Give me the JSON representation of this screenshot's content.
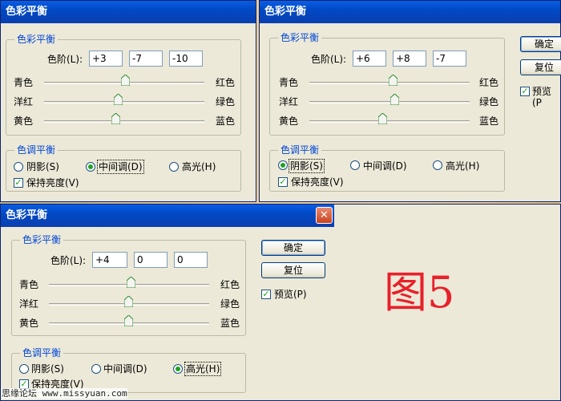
{
  "dialogs": [
    {
      "title": "色彩平衡",
      "color_balance": {
        "group_title": "色彩平衡",
        "levels_label": "色阶(L):",
        "levels": [
          "+3",
          "-7",
          "-10"
        ],
        "sliders": [
          {
            "left": "青色",
            "right": "红色"
          },
          {
            "left": "洋红",
            "right": "绿色"
          },
          {
            "left": "黄色",
            "right": "蓝色"
          }
        ]
      },
      "tone_balance": {
        "group_title": "色调平衡",
        "options": [
          "阴影(S)",
          "中间调(D)",
          "高光(H)"
        ],
        "selected": "中间调(D)",
        "preserve_luminosity": "保持亮度(V)",
        "preserve_checked": true
      }
    },
    {
      "title": "色彩平衡",
      "color_balance": {
        "group_title": "色彩平衡",
        "levels_label": "色阶(L):",
        "levels": [
          "+6",
          "+8",
          "-7"
        ],
        "sliders": [
          {
            "left": "青色",
            "right": "红色"
          },
          {
            "left": "洋红",
            "right": "绿色"
          },
          {
            "left": "黄色",
            "right": "蓝色"
          }
        ]
      },
      "tone_balance": {
        "group_title": "色调平衡",
        "options": [
          "阴影(S)",
          "中间调(D)",
          "高光(H)"
        ],
        "selected": "阴影(S)",
        "preserve_luminosity": "保持亮度(V)",
        "preserve_checked": true
      },
      "buttons": {
        "ok": "确定",
        "reset": "复位"
      },
      "preview": {
        "label": "预览(P",
        "checked": true
      }
    },
    {
      "title": "色彩平衡",
      "close_glyph": "✕",
      "color_balance": {
        "group_title": "色彩平衡",
        "levels_label": "色阶(L):",
        "levels": [
          "+4",
          "0",
          "0"
        ],
        "sliders": [
          {
            "left": "青色",
            "right": "红色"
          },
          {
            "left": "洋红",
            "right": "绿色"
          },
          {
            "left": "黄色",
            "right": "蓝色"
          }
        ]
      },
      "tone_balance": {
        "group_title": "色调平衡",
        "options": [
          "阴影(S)",
          "中间调(D)",
          "高光(H)"
        ],
        "selected": "高光(H)",
        "preserve_luminosity": "保持亮度(V)",
        "preserve_checked": true
      },
      "buttons": {
        "ok": "确定",
        "reset": "复位"
      },
      "preview": {
        "label": "预览(P)",
        "checked": true
      }
    }
  ],
  "figure_label": "图5",
  "watermark": "思缘论坛 www.missyuan.com",
  "colors": {
    "title_bar": "#0a5de6",
    "dialog_bg": "#ece9d8",
    "group_title": "#0046d5",
    "figure_label": "#e8202a"
  }
}
